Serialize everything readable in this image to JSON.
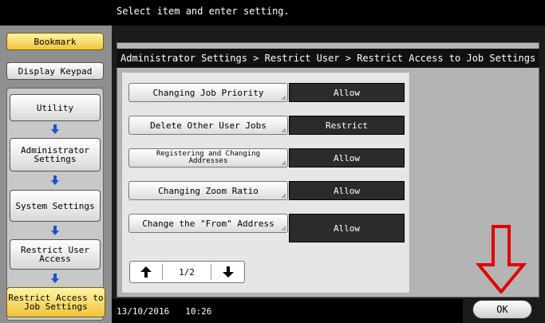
{
  "message": "Select item and enter setting.",
  "sidebar": {
    "bookmark": "Bookmark",
    "display_keypad": "Display Keypad",
    "flow": [
      "Utility",
      "Administrator Settings",
      "System Settings",
      "Restrict User Access",
      "Restrict Access to Job Settings"
    ]
  },
  "breadcrumb": "Administrator Settings > Restrict User > Restrict Access to Job Settings",
  "settings": [
    {
      "label": "Changing Job Priority",
      "value": "Allow"
    },
    {
      "label": "Delete Other User Jobs",
      "value": "Restrict"
    },
    {
      "label": "Registering and Changing Addresses",
      "value": "Allow"
    },
    {
      "label": "Changing Zoom Ratio",
      "value": "Allow"
    },
    {
      "label": "Change the \"From\" Address",
      "value": "Allow"
    }
  ],
  "pager": {
    "page": "1/2",
    "up_icon": "up-arrow-icon",
    "down_icon": "down-arrow-icon"
  },
  "status": {
    "date": "13/10/2016",
    "time": "10:26"
  },
  "ok_label": "OK",
  "colors": {
    "annotation_red": "#e00000",
    "highlight_yellow": "#f0c43a"
  }
}
